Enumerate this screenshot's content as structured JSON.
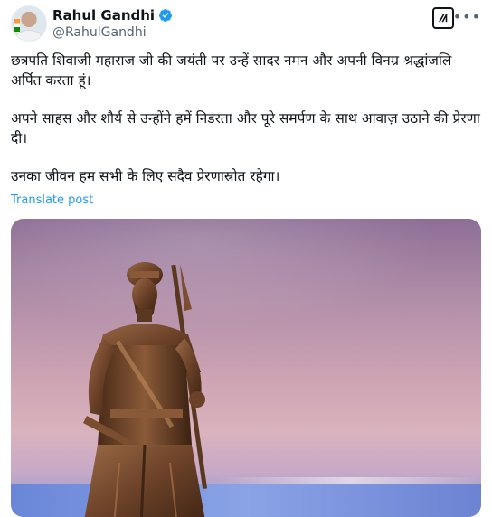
{
  "author": {
    "display_name": "Rahul Gandhi",
    "handle": "@RahulGandhi",
    "verified": true
  },
  "icons": {
    "verified": "verified-badge-icon",
    "grok": "grok-icon",
    "more": "more-icon"
  },
  "tweet": {
    "paragraphs": [
      "छत्रपति शिवाजी महाराज जी की जयंती पर उन्हें सादर नमन और अपनी विनम्र श्रद्धांजलि अर्पित करता हूं।",
      "अपने साहस और शौर्य से उन्होंने हमें निडरता और पूरे समर्पण के साथ आवाज़ उठाने की प्रेरणा दी।",
      "उनका जीवन हम सभी के लिए सदैव प्रेरणास्रोत रहेगा।"
    ],
    "translate_label": "Translate post"
  },
  "colors": {
    "link": "#1d9bf0",
    "verified": "#1d9bf0",
    "secondary_text": "#536471"
  }
}
